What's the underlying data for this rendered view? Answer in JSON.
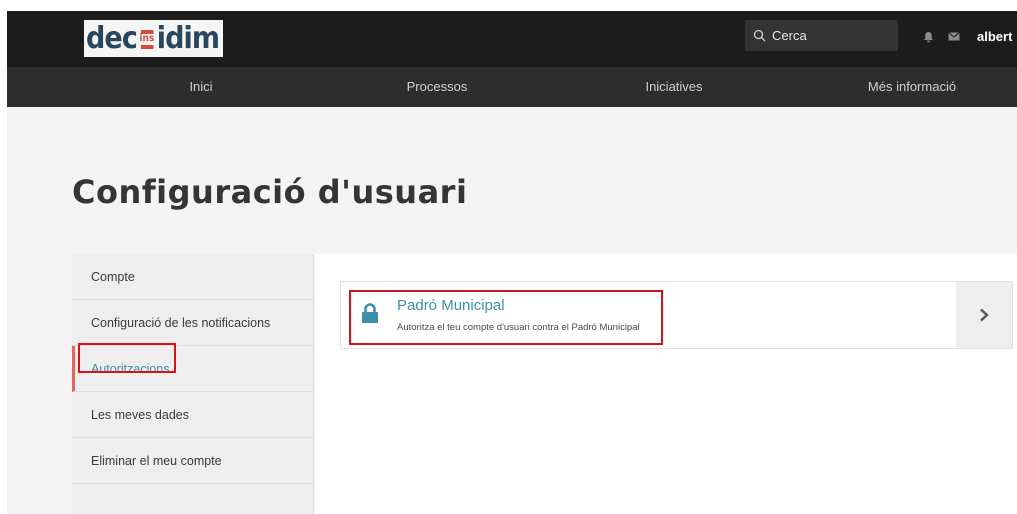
{
  "header": {
    "logo": {
      "left": "dec",
      "mid": "ins",
      "right": "idim"
    },
    "search_placeholder": "Cerca",
    "user_name": "albert",
    "icons": [
      "search-icon",
      "bell-icon",
      "mail-icon"
    ]
  },
  "nav": {
    "items": [
      {
        "label": "Inici"
      },
      {
        "label": "Processos"
      },
      {
        "label": "Iniciatives"
      },
      {
        "label": "Més informació"
      }
    ]
  },
  "page": {
    "title": "Configuració d'usuari"
  },
  "sidebar": {
    "items": [
      {
        "label": "Compte"
      },
      {
        "label": "Configuració de les notificacions"
      },
      {
        "label": "Autoritzacions",
        "active": true
      },
      {
        "label": "Les meves dades"
      },
      {
        "label": "Eliminar el meu compte"
      }
    ]
  },
  "authorizations": [
    {
      "title": "Padró Municipal",
      "description": "Autoritza el teu compte d'usuari contra el Padró Municipal",
      "icon": "lock-icon"
    }
  ],
  "colors": {
    "topbar": "#1c1c1c",
    "nav": "#2d2d2d",
    "accent_link": "#3e8faa",
    "active_marker": "#e0675c",
    "highlight_box": "#d4141c"
  }
}
